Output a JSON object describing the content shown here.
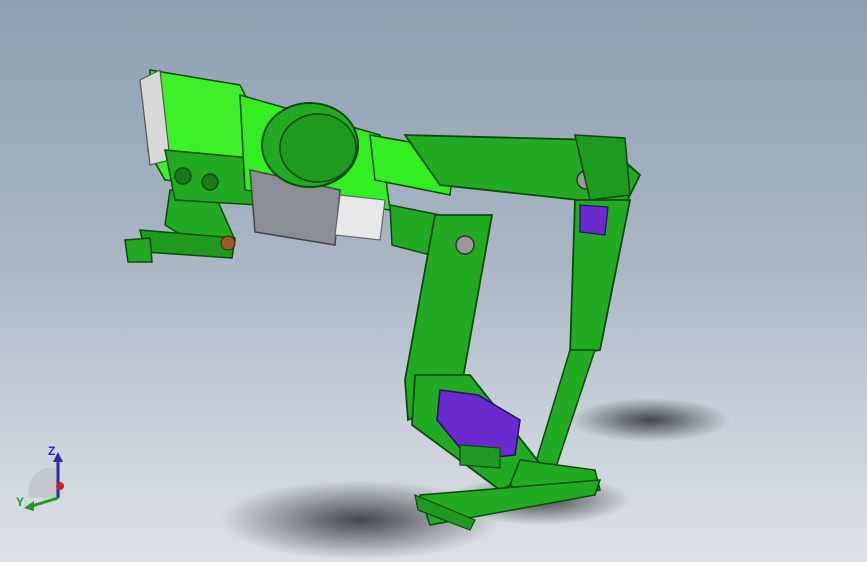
{
  "viewport": {
    "background_top": "#8e9fb3",
    "background_bottom": "#dde1e6"
  },
  "model": {
    "part_color": "#22aa22",
    "highlight_color": "#33ee22",
    "motor_color": "#6a2acf",
    "body_gray": "#8a8f96"
  },
  "triad": {
    "z_label": "Z",
    "y_label": "Y",
    "z_color": "#2a2aaa",
    "y_color": "#1e9a1e",
    "x_color": "#cc2222"
  }
}
